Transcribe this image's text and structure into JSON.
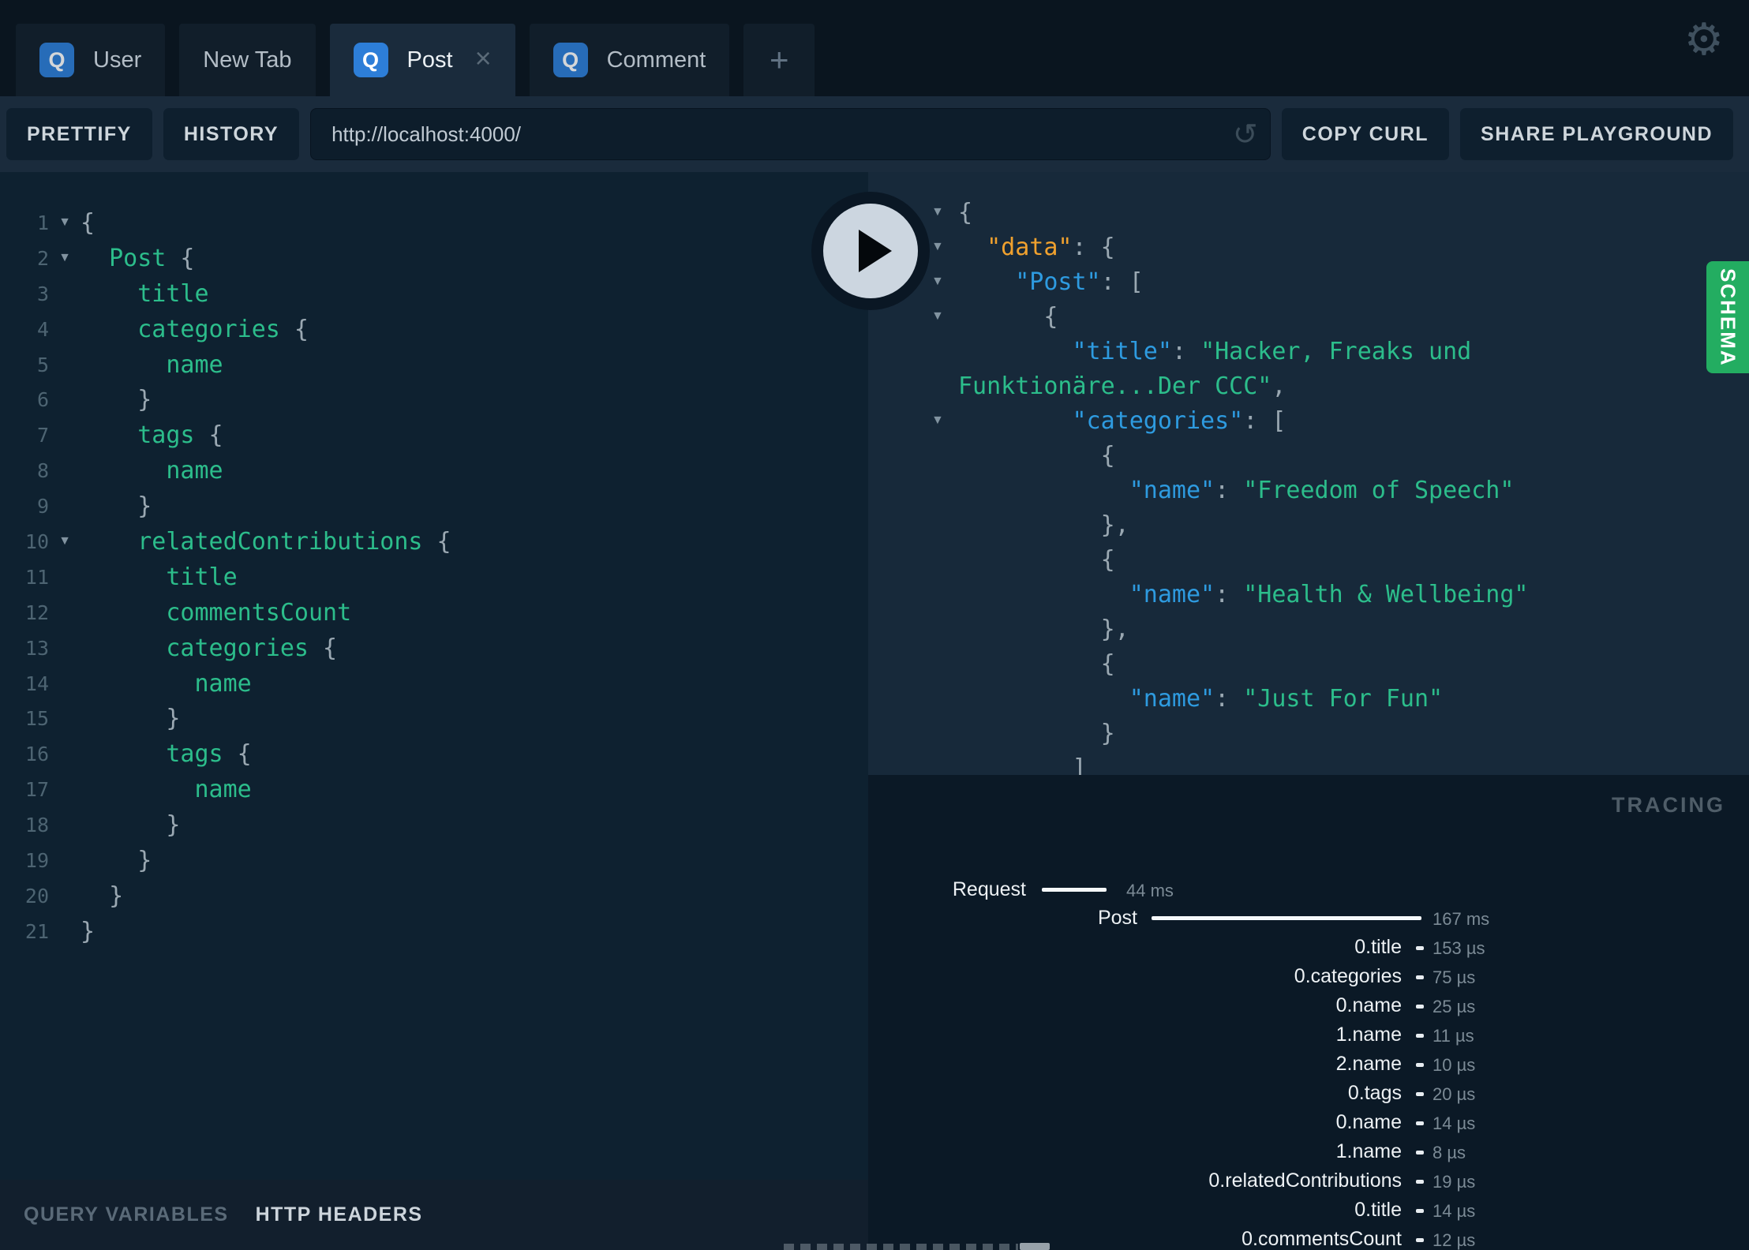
{
  "tabbar": {
    "tabs": [
      {
        "badge": "Q",
        "label": "User",
        "active": false,
        "closable": false
      },
      {
        "badge": null,
        "label": "New Tab",
        "active": false,
        "closable": false
      },
      {
        "badge": "Q",
        "label": "Post",
        "active": true,
        "closable": true,
        "close_label": "×"
      },
      {
        "badge": "Q",
        "label": "Comment",
        "active": false,
        "closable": false
      }
    ],
    "add_tab_label": "+",
    "settings_icon": "⚙"
  },
  "toolbar": {
    "prettify_label": "PRETTIFY",
    "history_label": "HISTORY",
    "url_value": "http://localhost:4000/",
    "reload_icon": "↺",
    "copy_curl_label": "COPY CURL",
    "share_label": "SHARE PLAYGROUND"
  },
  "query_editor": {
    "lines": [
      {
        "num": 1,
        "fold": true,
        "seg": [
          [
            "{",
            "p"
          ]
        ]
      },
      {
        "num": 2,
        "fold": true,
        "seg": [
          [
            "  ",
            "p"
          ],
          [
            "Post",
            "g"
          ],
          [
            " {",
            "p"
          ]
        ]
      },
      {
        "num": 3,
        "fold": false,
        "seg": [
          [
            "    ",
            "p"
          ],
          [
            "title",
            "g"
          ]
        ]
      },
      {
        "num": 4,
        "fold": false,
        "seg": [
          [
            "    ",
            "p"
          ],
          [
            "categories",
            "g"
          ],
          [
            " {",
            "p"
          ]
        ]
      },
      {
        "num": 5,
        "fold": false,
        "seg": [
          [
            "      ",
            "p"
          ],
          [
            "name",
            "g"
          ]
        ]
      },
      {
        "num": 6,
        "fold": false,
        "seg": [
          [
            "    }",
            "p"
          ]
        ]
      },
      {
        "num": 7,
        "fold": false,
        "seg": [
          [
            "    ",
            "p"
          ],
          [
            "tags",
            "g"
          ],
          [
            " {",
            "p"
          ]
        ]
      },
      {
        "num": 8,
        "fold": false,
        "seg": [
          [
            "      ",
            "p"
          ],
          [
            "name",
            "g"
          ]
        ]
      },
      {
        "num": 9,
        "fold": false,
        "seg": [
          [
            "    }",
            "p"
          ]
        ]
      },
      {
        "num": 10,
        "fold": true,
        "seg": [
          [
            "    ",
            "p"
          ],
          [
            "relatedContributions",
            "g"
          ],
          [
            " {",
            "p"
          ]
        ]
      },
      {
        "num": 11,
        "fold": false,
        "seg": [
          [
            "      ",
            "p"
          ],
          [
            "title",
            "g"
          ]
        ]
      },
      {
        "num": 12,
        "fold": false,
        "seg": [
          [
            "      ",
            "p"
          ],
          [
            "commentsCount",
            "g"
          ]
        ]
      },
      {
        "num": 13,
        "fold": false,
        "seg": [
          [
            "      ",
            "p"
          ],
          [
            "categories",
            "g"
          ],
          [
            " {",
            "p"
          ]
        ]
      },
      {
        "num": 14,
        "fold": false,
        "seg": [
          [
            "        ",
            "p"
          ],
          [
            "name",
            "g"
          ]
        ]
      },
      {
        "num": 15,
        "fold": false,
        "seg": [
          [
            "      }",
            "p"
          ]
        ]
      },
      {
        "num": 16,
        "fold": false,
        "seg": [
          [
            "      ",
            "p"
          ],
          [
            "tags",
            "g"
          ],
          [
            " {",
            "p"
          ]
        ]
      },
      {
        "num": 17,
        "fold": false,
        "seg": [
          [
            "        ",
            "p"
          ],
          [
            "name",
            "g"
          ]
        ]
      },
      {
        "num": 18,
        "fold": false,
        "seg": [
          [
            "      }",
            "p"
          ]
        ]
      },
      {
        "num": 19,
        "fold": false,
        "seg": [
          [
            "    }",
            "p"
          ]
        ]
      },
      {
        "num": 20,
        "fold": false,
        "seg": [
          [
            "  }",
            "p"
          ]
        ]
      },
      {
        "num": 21,
        "fold": false,
        "seg": [
          [
            "}",
            "p"
          ]
        ]
      }
    ]
  },
  "response_viewer": {
    "play_icon": "play-triangle",
    "lines": [
      {
        "fold": true,
        "seg": [
          [
            "{",
            "p"
          ]
        ]
      },
      {
        "fold": true,
        "seg": [
          [
            "  ",
            "p"
          ],
          [
            "\"data\"",
            "o"
          ],
          [
            ": {",
            "p"
          ]
        ]
      },
      {
        "fold": true,
        "seg": [
          [
            "    ",
            "p"
          ],
          [
            "\"Post\"",
            "b"
          ],
          [
            ": [",
            "p"
          ]
        ]
      },
      {
        "fold": true,
        "seg": [
          [
            "      {",
            "p"
          ]
        ]
      },
      {
        "fold": false,
        "seg": [
          [
            "        ",
            "p"
          ],
          [
            "\"title\"",
            "b"
          ],
          [
            ": ",
            "p"
          ],
          [
            "\"Hacker, Freaks und",
            "s"
          ]
        ]
      },
      {
        "fold": false,
        "seg": [
          [
            "Funktionäre...Der CCC\"",
            "s"
          ],
          [
            ",",
            "p"
          ]
        ]
      },
      {
        "fold": true,
        "seg": [
          [
            "        ",
            "p"
          ],
          [
            "\"categories\"",
            "b"
          ],
          [
            ": [",
            "p"
          ]
        ]
      },
      {
        "fold": false,
        "seg": [
          [
            "          {",
            "p"
          ]
        ]
      },
      {
        "fold": false,
        "seg": [
          [
            "            ",
            "p"
          ],
          [
            "\"name\"",
            "b"
          ],
          [
            ": ",
            "p"
          ],
          [
            "\"Freedom of Speech\"",
            "s"
          ]
        ]
      },
      {
        "fold": false,
        "seg": [
          [
            "          },",
            "p"
          ]
        ]
      },
      {
        "fold": false,
        "seg": [
          [
            "          {",
            "p"
          ]
        ]
      },
      {
        "fold": false,
        "seg": [
          [
            "            ",
            "p"
          ],
          [
            "\"name\"",
            "b"
          ],
          [
            ": ",
            "p"
          ],
          [
            "\"Health & Wellbeing\"",
            "s"
          ]
        ]
      },
      {
        "fold": false,
        "seg": [
          [
            "          },",
            "p"
          ]
        ]
      },
      {
        "fold": false,
        "seg": [
          [
            "          {",
            "p"
          ]
        ]
      },
      {
        "fold": false,
        "seg": [
          [
            "            ",
            "p"
          ],
          [
            "\"name\"",
            "b"
          ],
          [
            ": ",
            "p"
          ],
          [
            "\"Just For Fun\"",
            "s"
          ]
        ]
      },
      {
        "fold": false,
        "seg": [
          [
            "          }",
            "p"
          ]
        ]
      },
      {
        "fold": false,
        "seg": [
          [
            "        ]",
            "p"
          ]
        ]
      }
    ]
  },
  "schema_tab": {
    "label": "SCHEMA"
  },
  "bottom_bar": {
    "query_variables_label": "QUERY VARIABLES",
    "http_headers_label": "HTTP HEADERS"
  },
  "tracing": {
    "header": "TRACING",
    "spans": [
      {
        "label": "Request",
        "duration": "44 ms"
      },
      {
        "label": "Post",
        "duration": "167 ms"
      }
    ],
    "fields": [
      {
        "path": "0.title",
        "duration": "153 µs"
      },
      {
        "path": "0.categories",
        "duration": "75 µs"
      },
      {
        "path": "0.name",
        "duration": "25 µs"
      },
      {
        "path": "1.name",
        "duration": "11 µs"
      },
      {
        "path": "2.name",
        "duration": "10 µs"
      },
      {
        "path": "0.tags",
        "duration": "20 µs"
      },
      {
        "path": "0.name",
        "duration": "14 µs"
      },
      {
        "path": "1.name",
        "duration": "8 µs"
      },
      {
        "path": "0.relatedContributions",
        "duration": "19 µs"
      },
      {
        "path": "0.title",
        "duration": "14 µs"
      },
      {
        "path": "0.commentsCount",
        "duration": "12 µs"
      }
    ]
  },
  "colors": {
    "accent_blue": "#2d7ed8",
    "key_blue": "#2e9be0",
    "key_orange": "#f0a12e",
    "string_green": "#2cbd8b",
    "schema_green": "#23ad61",
    "punct_grey": "#9aa8b2"
  }
}
